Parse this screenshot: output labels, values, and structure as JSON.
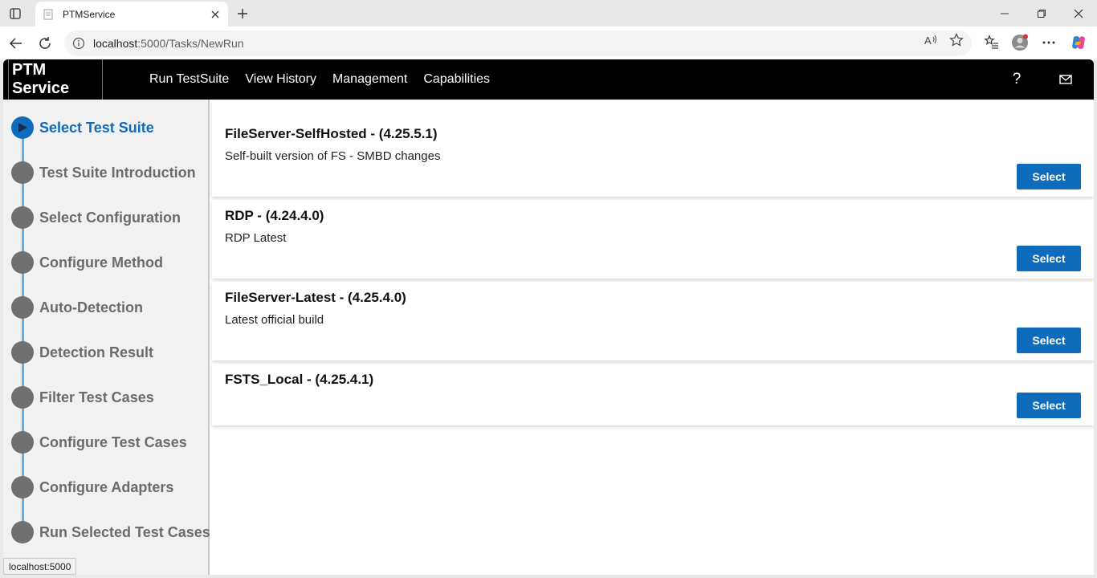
{
  "browser": {
    "tab_title": "PTMService",
    "url_host": "localhost",
    "url_path": ":5000/Tasks/NewRun",
    "status_text": "localhost:5000"
  },
  "app": {
    "brand": "PTM Service",
    "nav": [
      "Run TestSuite",
      "View History",
      "Management",
      "Capabilities"
    ],
    "help_glyph": "?"
  },
  "steps": [
    {
      "label": "Select Test Suite",
      "active": true
    },
    {
      "label": "Test Suite Introduction",
      "active": false
    },
    {
      "label": "Select Configuration",
      "active": false
    },
    {
      "label": "Configure Method",
      "active": false
    },
    {
      "label": "Auto-Detection",
      "active": false
    },
    {
      "label": "Detection Result",
      "active": false
    },
    {
      "label": "Filter Test Cases",
      "active": false
    },
    {
      "label": "Configure Test Cases",
      "active": false
    },
    {
      "label": "Configure Adapters",
      "active": false
    },
    {
      "label": "Run Selected Test Cases",
      "active": false
    }
  ],
  "suites": [
    {
      "title": "FileServer-SelfHosted - (4.25.5.1)",
      "description": "Self-built version of FS - SMBD changes",
      "button": "Select"
    },
    {
      "title": "RDP - (4.24.4.0)",
      "description": "RDP Latest",
      "button": "Select"
    },
    {
      "title": "FileServer-Latest - (4.25.4.0)",
      "description": "Latest official build",
      "button": "Select"
    },
    {
      "title": "FSTS_Local - (4.25.4.1)",
      "description": "",
      "button": "Select"
    }
  ],
  "colors": {
    "accent": "#0f6cbd",
    "step_line": "#5bb0f0",
    "step_inactive": "#707070",
    "appbar": "#000000"
  }
}
